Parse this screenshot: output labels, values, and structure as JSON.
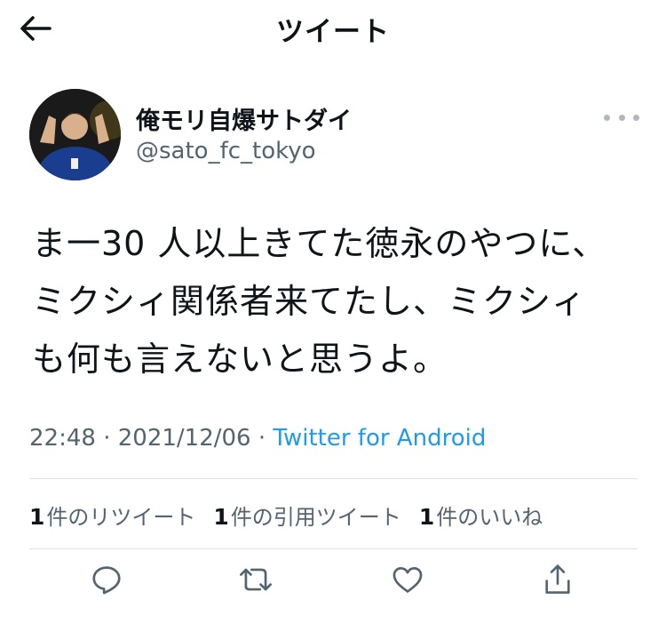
{
  "header": {
    "title": "ツイート"
  },
  "tweet": {
    "display_name": "俺モリ自爆サトダイ",
    "handle": "@sato_fc_tokyo",
    "text": "ま一30 人以上きてた徳永のやつに、\nミクシィ関係者来てたし、ミクシィ\nも何も言えないと思うよ。",
    "time": "22:48",
    "separator": "·",
    "date": "2021/12/06",
    "source": "Twitter for Android"
  },
  "stats": {
    "retweets_count": "1",
    "retweets_label": "件のリツイート",
    "quotes_count": "1",
    "quotes_label": "件の引用ツイート",
    "likes_count": "1",
    "likes_label": "件のいいね"
  },
  "icons": {
    "back": "arrow-left-icon",
    "more": "more-dots-icon",
    "reply": "reply-icon",
    "retweet": "retweet-icon",
    "like": "heart-icon",
    "share": "share-icon"
  },
  "colors": {
    "accent": "#1d9bf0",
    "muted": "#536471",
    "text": "#0f1419"
  }
}
